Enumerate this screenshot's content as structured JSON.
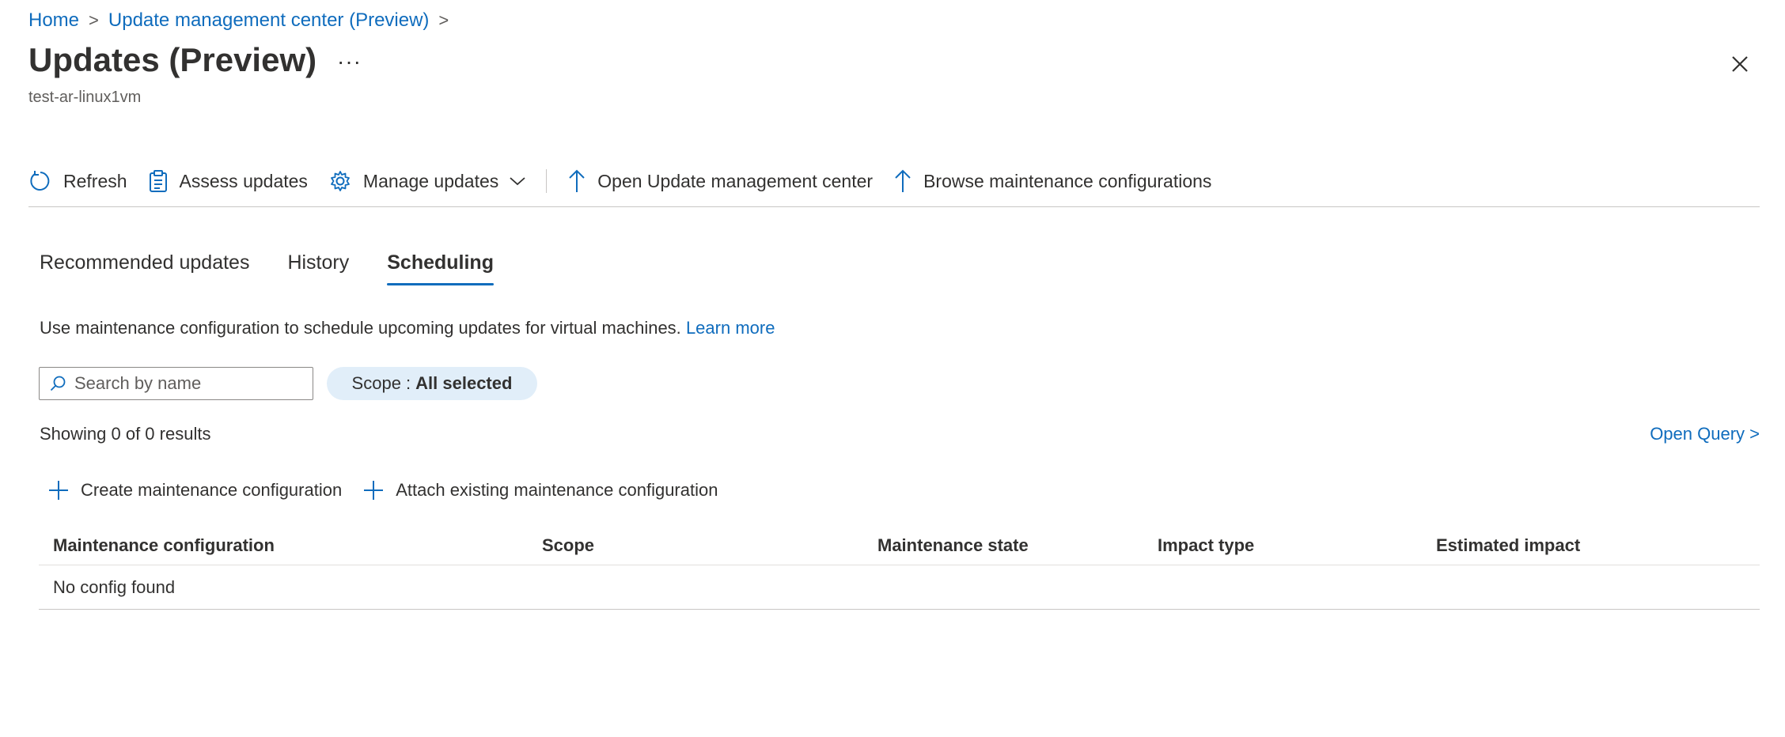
{
  "breadcrumb": {
    "home": "Home",
    "parent": "Update management center (Preview)",
    "sep": ">"
  },
  "page": {
    "title": "Updates (Preview)",
    "more": "···",
    "subtitle": "test-ar-linux1vm"
  },
  "toolbar": {
    "refresh": "Refresh",
    "assess": "Assess updates",
    "manage": "Manage updates",
    "open_umc": "Open Update management center",
    "browse": "Browse maintenance configurations"
  },
  "tabs": [
    "Recommended updates",
    "History",
    "Scheduling"
  ],
  "active_tab": "Scheduling",
  "scheduling": {
    "description": "Use maintenance configuration to schedule upcoming updates for virtual machines.",
    "learn_more": "Learn more",
    "search_placeholder": "Search by name",
    "scope_label": "Scope :",
    "scope_value": "All selected",
    "results": "Showing 0 of 0 results",
    "open_query": "Open Query >",
    "create": "Create maintenance configuration",
    "attach": "Attach existing maintenance configuration",
    "columns": [
      "Maintenance configuration",
      "Scope",
      "Maintenance state",
      "Impact type",
      "Estimated impact"
    ],
    "empty": "No config found"
  },
  "colors": {
    "accent": "#0f6cbd",
    "pill_bg": "#e1eef9",
    "text": "#323130"
  }
}
